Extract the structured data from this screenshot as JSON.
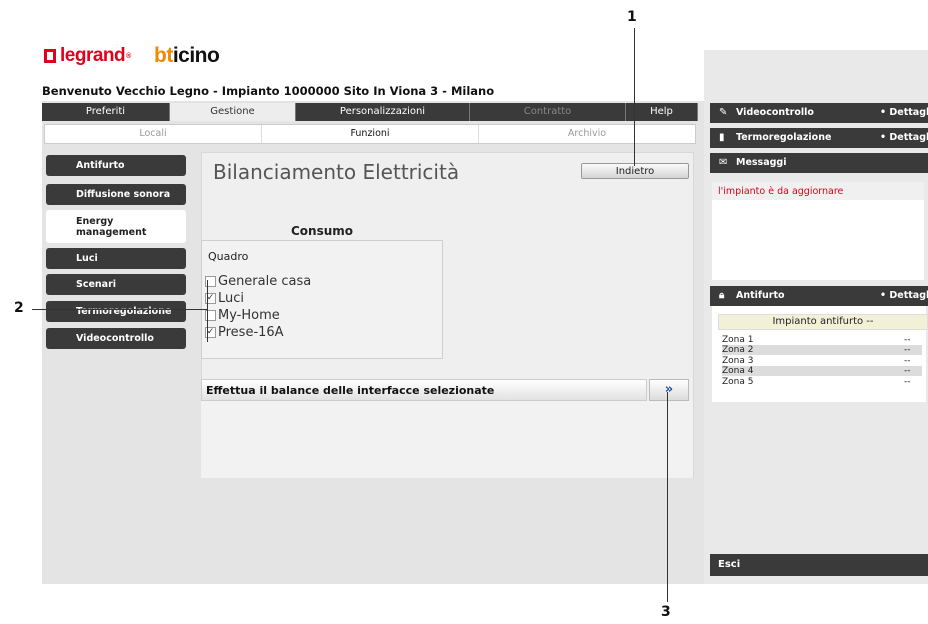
{
  "brand": {
    "legrand": "legrand",
    "bticino_b": "bt",
    "bticino_rest": "icino"
  },
  "welcome": "Benvenuto Vecchio Legno - Impianto 1000000 Sito In Viona 3 - Milano",
  "tabs": [
    {
      "label": "Preferiti"
    },
    {
      "label": "Gestione"
    },
    {
      "label": "Personalizzazioni"
    },
    {
      "label": "Contratto"
    },
    {
      "label": "Help"
    }
  ],
  "subtabs": [
    {
      "label": "Locali"
    },
    {
      "label": "Funzioni"
    },
    {
      "label": "Archivio"
    }
  ],
  "menu": [
    {
      "label": "Antifurto"
    },
    {
      "label": "Diffusione sonora"
    },
    {
      "label": "Energy\nmanagement"
    },
    {
      "label": "Luci"
    },
    {
      "label": "Scenari"
    },
    {
      "label": "Termoregolazione"
    },
    {
      "label": "Videocontrollo"
    }
  ],
  "main": {
    "title": "Bilanciamento Elettricità",
    "back_label": "Indietro",
    "consumo_label": "Consumo",
    "quadro_label": "Quadro",
    "options": [
      {
        "label": "Generale casa",
        "checked": false,
        "mark": ""
      },
      {
        "label": "Luci",
        "checked": true,
        "mark": "✓"
      },
      {
        "label": "My-Home",
        "checked": false,
        "mark": ""
      },
      {
        "label": "Prese-16A",
        "checked": true,
        "mark": "✓"
      }
    ],
    "balance_label": "Effettua il balance delle interfacce selezionate",
    "go_label": "»"
  },
  "right": {
    "video": {
      "label": "Videocontrollo",
      "details": "• Dettagli"
    },
    "termo": {
      "label": "Termoregolazione",
      "details": "• Dettagli"
    },
    "messaggi": {
      "label": "Messaggi",
      "message": "l'impianto è da aggiornare"
    },
    "antifurto": {
      "label": "Antifurto",
      "details": "• Dettagli",
      "title": "Impianto antifurto --",
      "zones": [
        {
          "name": "Zona 1",
          "value": "--"
        },
        {
          "name": "Zona 2",
          "value": "--"
        },
        {
          "name": "Zona 3",
          "value": "--"
        },
        {
          "name": "Zona 4",
          "value": "--"
        },
        {
          "name": "Zona 5",
          "value": "--"
        }
      ]
    },
    "esci": "Esci"
  },
  "callouts": {
    "one": "1",
    "two": "2",
    "three": "3"
  },
  "colors": {
    "accent_red": "#e2001a",
    "bticino_orange": "#f08a00",
    "dark_button": "#3a3a3a"
  }
}
